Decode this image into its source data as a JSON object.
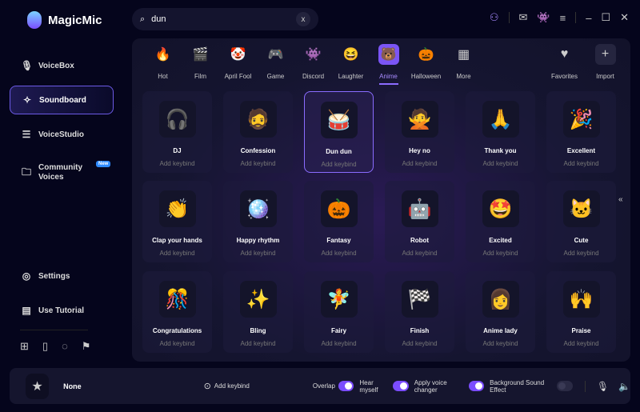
{
  "app": {
    "title": "MagicMic"
  },
  "search": {
    "value": "dun",
    "clear": "x"
  },
  "top_icons": [
    "user-icon",
    "mail-icon",
    "discord-icon",
    "menu-icon",
    "minimize-icon",
    "maximize-icon",
    "close-icon"
  ],
  "sidebar": {
    "items": [
      {
        "label": "VoiceBox",
        "icon": "🎙"
      },
      {
        "label": "Soundboard",
        "icon": "✧"
      },
      {
        "label": "VoiceStudio",
        "icon": "☰"
      },
      {
        "label": "Community Voices",
        "icon": "🗀",
        "badge": "New"
      },
      {
        "label": "Settings",
        "icon": "◎"
      },
      {
        "label": "Use Tutorial",
        "icon": "▤"
      }
    ]
  },
  "tabs": [
    {
      "label": "Hot",
      "icon": "🔥"
    },
    {
      "label": "Film",
      "icon": "🎬"
    },
    {
      "label": "April Fool",
      "icon": "🤡"
    },
    {
      "label": "Game",
      "icon": "🎮"
    },
    {
      "label": "Discord",
      "icon": "👾"
    },
    {
      "label": "Laughter",
      "icon": "😆"
    },
    {
      "label": "Anime",
      "icon": "🐻",
      "active": true
    },
    {
      "label": "Halloween",
      "icon": "🎃"
    },
    {
      "label": "More",
      "icon": "▦"
    }
  ],
  "right_tabs": [
    {
      "label": "Favorites",
      "icon": "♥"
    },
    {
      "label": "Import",
      "icon": "+"
    }
  ],
  "sounds": [
    {
      "name": "DJ",
      "icon": "🎧"
    },
    {
      "name": "Confession",
      "icon": "🧔"
    },
    {
      "name": "Dun dun",
      "icon": "🥁",
      "selected": true
    },
    {
      "name": "Hey no",
      "icon": "🙅"
    },
    {
      "name": "Thank you",
      "icon": "🙏"
    },
    {
      "name": "Excellent",
      "icon": "🎉"
    },
    {
      "name": "Clap your hands",
      "icon": "👏"
    },
    {
      "name": "Happy rhythm",
      "icon": "🪩"
    },
    {
      "name": "Fantasy",
      "icon": "🎃"
    },
    {
      "name": "Robot",
      "icon": "🤖"
    },
    {
      "name": "Excited",
      "icon": "🤩"
    },
    {
      "name": "Cute",
      "icon": "🐱"
    },
    {
      "name": "Congratulations",
      "icon": "🎊"
    },
    {
      "name": "Bling",
      "icon": "✨"
    },
    {
      "name": "Fairy",
      "icon": "🧚"
    },
    {
      "name": "Finish",
      "icon": "🏁"
    },
    {
      "name": "Anime lady",
      "icon": "👩"
    },
    {
      "name": "Praise",
      "icon": "🙌"
    }
  ],
  "keybind_label": "Add keybind",
  "bottom": {
    "current": "None",
    "add_keybind": "Add keybind",
    "toggles": [
      {
        "label": "Overlap",
        "on": true
      },
      {
        "label": "Hear myself",
        "on": true
      },
      {
        "label": "Apply voice changer",
        "on": true
      },
      {
        "label": "Background Sound Effect",
        "on": false
      }
    ]
  },
  "colors": {
    "accent": "#7b4dff",
    "background": "#05051c"
  }
}
